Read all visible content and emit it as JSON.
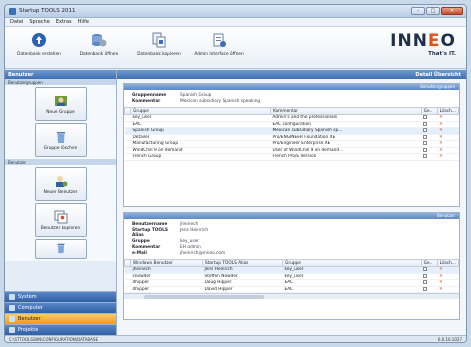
{
  "window": {
    "title": "Startup TOOLS 2011",
    "minimize": "–",
    "maximize": "□",
    "close": "✕"
  },
  "menu": [
    "Datei",
    "Sprache",
    "Extras",
    "Hilfe"
  ],
  "toolbar": {
    "items": [
      {
        "label": "Datenbank erstellen",
        "icon": "database-create-icon"
      },
      {
        "label": "Datenbank öffnen",
        "icon": "database-open-icon"
      },
      {
        "label": "Datenbank kopieren",
        "icon": "database-copy-icon"
      },
      {
        "label": "Admin Interface öffnen",
        "icon": "admin-interface-icon"
      }
    ]
  },
  "brand": {
    "name_part1": "INN",
    "name_part2": "E",
    "name_part3": "O",
    "slogan": "That's IT."
  },
  "sidebar": {
    "header": "Benutzer",
    "group_section": "Benutzergruppen",
    "group_buttons": [
      {
        "label": "Neue Gruppe"
      },
      {
        "label": "Gruppe löschen"
      }
    ],
    "user_section": "Benutzer",
    "user_buttons": [
      {
        "label": "Neuer Benutzer"
      },
      {
        "label": "Benutzer kopieren"
      },
      {
        "label": ""
      }
    ],
    "nav": [
      {
        "label": "System",
        "active": false
      },
      {
        "label": "Computer",
        "active": false
      },
      {
        "label": "Benutzer",
        "active": true
      },
      {
        "label": "Projekte",
        "active": false
      }
    ]
  },
  "main": {
    "header": "Detail Übersicht",
    "group_panel": {
      "title": "Benutzergruppen",
      "fields": [
        {
          "key": "Gruppenname",
          "value": "Spanish Group"
        },
        {
          "key": "Kommentar",
          "value": "Mexican subsidiary Spanish speaking"
        }
      ],
      "columns": [
        "Gruppe",
        "Kommentar",
        "Ge..",
        "Lösch..."
      ],
      "rows": [
        {
          "name": "key_user",
          "comment": "Admin's and the professionals",
          "selected": false
        },
        {
          "name": "EAC",
          "comment": "EAC configuration",
          "selected": false
        },
        {
          "name": "Spanish Group",
          "comment": "Mexican subsidiary Spanish sp...",
          "selected": true
        },
        {
          "name": "Detailer",
          "comment": "Pro/ENGINEER Foundation XE",
          "selected": false
        },
        {
          "name": "Manufacturing Group",
          "comment": "Pro/Engineer Enterprise XE",
          "selected": false
        },
        {
          "name": "WindChill 9 on demand",
          "comment": "User of WindChill 9 on demand...",
          "selected": false
        },
        {
          "name": "French Group",
          "comment": "French Pro/E Version",
          "selected": false
        }
      ]
    },
    "user_panel": {
      "title": "Benutzer",
      "fields": [
        {
          "key": "Benutzername",
          "value": "jheinech"
        },
        {
          "key": "Startup TOOLS Alias",
          "value": "Jens Heinrich"
        },
        {
          "key": "Gruppe",
          "value": "key_user"
        },
        {
          "key": "Kommentar",
          "value": "EH admin"
        },
        {
          "key": "e-Mail",
          "value": "jheinrich@inneo.com"
        }
      ],
      "columns": [
        "Windows Benutzer",
        "Startup TOOLS Alias",
        "Gruppe",
        "Ge..",
        "Lösch..."
      ],
      "rows": [
        {
          "user": "jheinech",
          "alias": "Jens Heinrich",
          "group": "key_user",
          "selected": true
        },
        {
          "user": "snowder",
          "alias": "Steffen Nowder",
          "group": "key_user",
          "selected": false
        },
        {
          "user": "dhipper",
          "alias": "Doug Hipper",
          "group": "EAC",
          "selected": false
        },
        {
          "user": "dhipper",
          "alias": "David Hipper",
          "group": "EAC",
          "selected": false
        }
      ]
    }
  },
  "status": {
    "path": "C:\\STTOOLS\\BIN\\CONFIGURATION\\DATABASE",
    "version": "6.0.10.1027"
  },
  "colors": {
    "accent": "#3f6fb3",
    "active_nav": "#f29b1a",
    "brand_e": "#e05418"
  }
}
